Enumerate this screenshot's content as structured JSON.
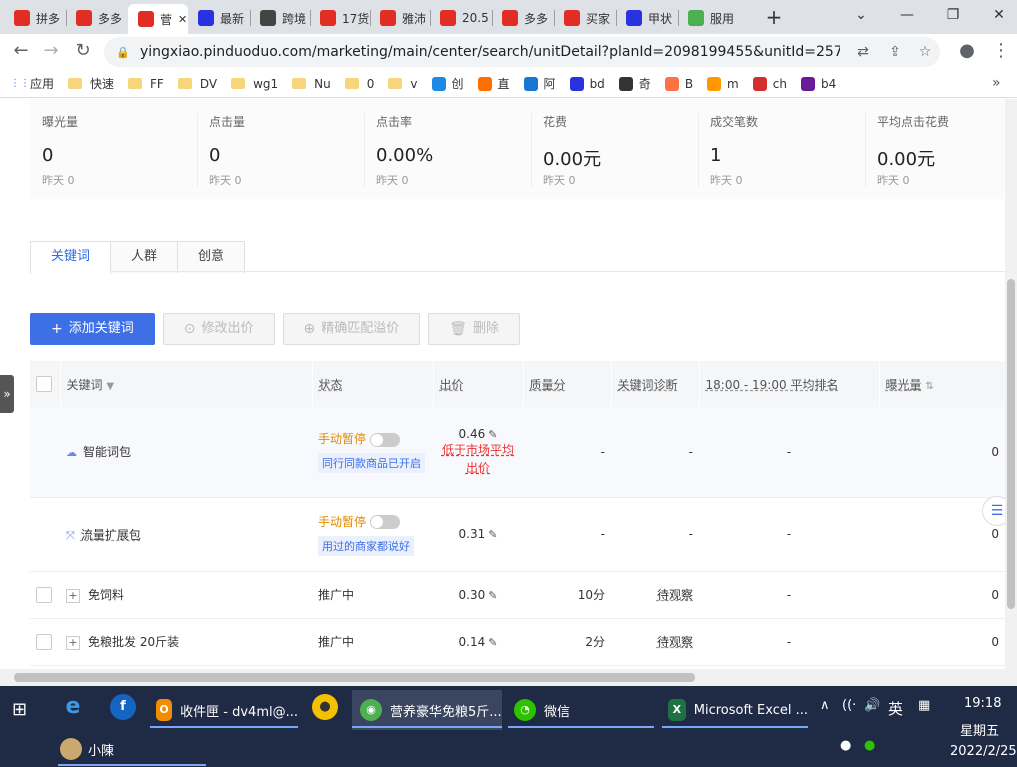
{
  "browser": {
    "tabs": [
      {
        "label": "拼多",
        "color": "#e02e24",
        "icon": "pdd-icon"
      },
      {
        "label": "多多",
        "color": "#e02e24",
        "icon": "pdd-icon"
      },
      {
        "label": "菅",
        "color": "#e02e24",
        "icon": "pdd-icon",
        "active": true
      },
      {
        "label": "最新",
        "color": "#2932e1",
        "icon": "baidu-paw-icon"
      },
      {
        "label": "跨境",
        "color": "#444444",
        "icon": "site-icon"
      },
      {
        "label": "17货",
        "color": "#e02e24",
        "icon": "17-icon"
      },
      {
        "label": "雅沛",
        "color": "#e02e24",
        "icon": "17-icon"
      },
      {
        "label": "20.5",
        "color": "#e02e24",
        "icon": "17-icon"
      },
      {
        "label": "多多",
        "color": "#e02e24",
        "icon": "17-icon"
      },
      {
        "label": "买家",
        "color": "#e02e24",
        "icon": "17-icon"
      },
      {
        "label": "甲状",
        "color": "#2932e1",
        "icon": "baidu-paw-icon"
      },
      {
        "label": "服用",
        "color": "#4caf50",
        "icon": "chrome-icon"
      }
    ],
    "url": "yingxiao.pinduoduo.com/marketing/main/center/search/unitDetail?planId=2098199455&unitId=25749..."
  },
  "bookmarks": [
    {
      "label": "应用",
      "kind": "apps"
    },
    {
      "label": "快速",
      "kind": "folder"
    },
    {
      "label": "FF",
      "kind": "folder"
    },
    {
      "label": "DV",
      "kind": "folder"
    },
    {
      "label": "wg1",
      "kind": "folder"
    },
    {
      "label": "Nu",
      "kind": "folder"
    },
    {
      "label": "0",
      "kind": "folder"
    },
    {
      "label": "v",
      "kind": "folder"
    },
    {
      "label": "创",
      "kind": "site",
      "color": "#1e88e5"
    },
    {
      "label": "直",
      "kind": "site",
      "color": "#ff6f00"
    },
    {
      "label": "阿",
      "kind": "site",
      "color": "#1976d2"
    },
    {
      "label": "bd",
      "kind": "site",
      "color": "#2932e1"
    },
    {
      "label": "奇",
      "kind": "site",
      "color": "#333333"
    },
    {
      "label": "B",
      "kind": "site",
      "color": "#ff7043"
    },
    {
      "label": "m",
      "kind": "site",
      "color": "#ff9800"
    },
    {
      "label": "ch",
      "kind": "site",
      "color": "#d32f2f"
    },
    {
      "label": "b4",
      "kind": "site",
      "color": "#6a1b9a"
    }
  ],
  "stats": [
    {
      "label": "曝光量",
      "value": "0",
      "sub": "昨天 0"
    },
    {
      "label": "点击量",
      "value": "0",
      "sub": "昨天 0"
    },
    {
      "label": "点击率",
      "value": "0.00%",
      "sub": "昨天 0"
    },
    {
      "label": "花费",
      "value": "0.00元",
      "sub": "昨天 0"
    },
    {
      "label": "成交笔数",
      "value": "1",
      "sub": "昨天 0"
    },
    {
      "label": "平均点击花费",
      "value": "0.00元",
      "sub": "昨天 0"
    }
  ],
  "page_tabs": [
    "关键词",
    "人群",
    "创意"
  ],
  "actions": {
    "add": "添加关键词",
    "edit_bid": "修改出价",
    "exact_premium": "精确匹配溢价",
    "delete": "删除"
  },
  "table": {
    "headers": {
      "keyword": "关键词",
      "status": "状态",
      "bid": "出价",
      "quality": "质量分",
      "diagnosis": "关键词诊断",
      "rank": "18:00 - 19:00 平均排名",
      "exposure": "曝光量"
    },
    "rows": [
      {
        "keyword": "智能词包",
        "status": "手动暂停",
        "hint": "同行同款商品已开启",
        "bid": "0.46",
        "warning": "低于市场平均出价",
        "quality": "-",
        "diagnosis": "-",
        "rank": "-",
        "exposure": "0"
      },
      {
        "keyword": "流量扩展包",
        "status": "手动暂停",
        "hint": "用过的商家都说好",
        "bid": "0.31",
        "quality": "-",
        "diagnosis": "-",
        "rank": "-",
        "exposure": "0"
      },
      {
        "keyword": "免饲料",
        "status": "推广中",
        "bid": "0.30",
        "quality": "10分",
        "diagnosis": "待观察",
        "rank": "-",
        "exposure": "0"
      },
      {
        "keyword": "免粮批发 20斤装",
        "status": "推广中",
        "bid": "0.14",
        "quality": "2分",
        "diagnosis": "待观察",
        "rank": "-",
        "exposure": "0"
      }
    ]
  },
  "taskbar": {
    "apps": [
      {
        "label": "收件匣 - dv4ml@...",
        "icon": "outlook-icon"
      },
      {
        "label": "营养豪华免粮5斤...",
        "icon": "chrome-icon"
      },
      {
        "label": "微信",
        "icon": "wechat-icon"
      },
      {
        "label": "Microsoft Excel ...",
        "icon": "excel-icon"
      }
    ],
    "user": "小陳",
    "ime": "英",
    "time": "19:18",
    "weekday": "星期五",
    "date": "2022/2/25"
  }
}
